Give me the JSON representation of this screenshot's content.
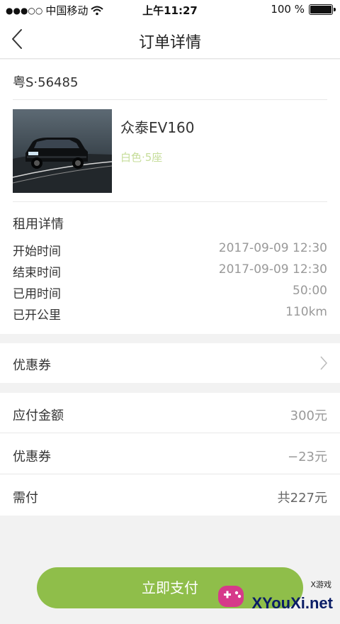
{
  "status_bar": {
    "signal": "●●●○○",
    "carrier": "中国移动",
    "time": "上午11:27",
    "battery_text": "100 %",
    "battery_level": 1.0
  },
  "nav": {
    "title": "订单详情",
    "back_icon": "chevron-left-icon"
  },
  "vehicle": {
    "plate": "粤S·56485",
    "name": "众泰EV160",
    "spec": "白色·5座"
  },
  "rental": {
    "title": "租用详情",
    "rows": [
      {
        "label": "开始时间",
        "value": "2017-09-09  12:30"
      },
      {
        "label": "结束时间",
        "value": "2017-09-09  12:30"
      },
      {
        "label": "已用时间",
        "value": "50:00"
      },
      {
        "label": "已开公里",
        "value": "110km"
      }
    ]
  },
  "coupon": {
    "label": "优惠券",
    "icon": "chevron-right-icon"
  },
  "payment": {
    "rows": [
      {
        "label": "应付金额",
        "value": "300元"
      },
      {
        "label": "优惠券",
        "value": "−23元"
      },
      {
        "label": "需付",
        "value": "共227元"
      }
    ]
  },
  "action": {
    "pay_label": "立即支付",
    "accent": "#8fbe4a"
  },
  "watermark": {
    "small": "X游戏",
    "text": "XYouXi.net"
  }
}
